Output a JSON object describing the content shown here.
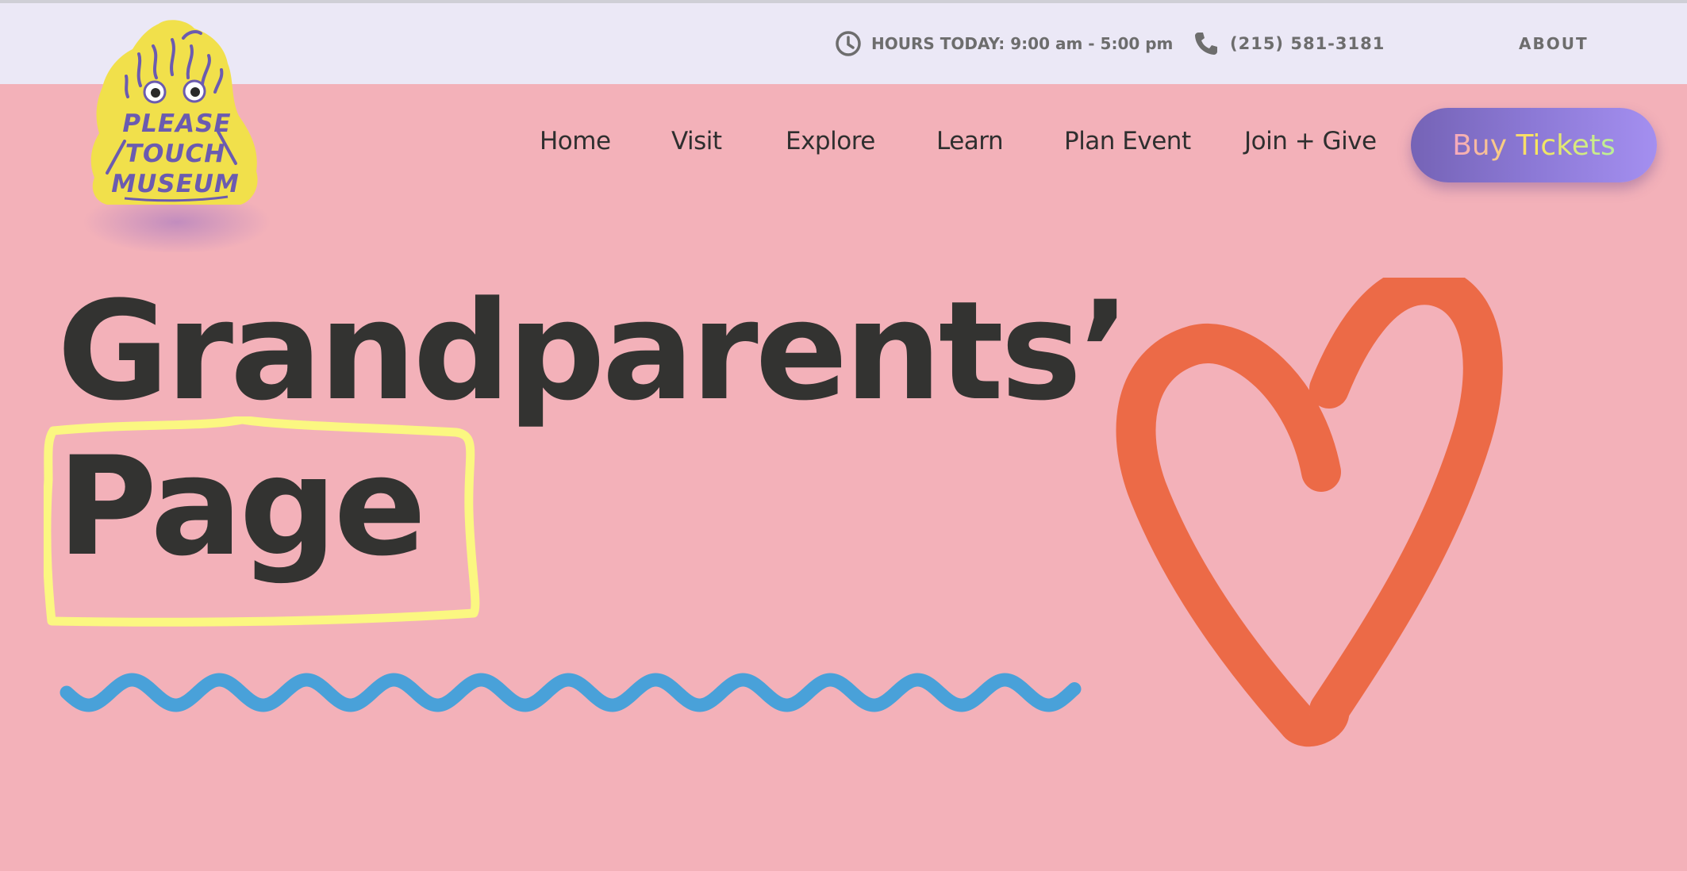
{
  "topbar": {
    "hours_label": "HOURS TODAY: 9:00 am - 5:00 pm",
    "phone": "(215) 581-3181",
    "about": "ABOUT"
  },
  "logo": {
    "line1": "PLEASE",
    "line2": "TOUCH",
    "line3": "MUSEUM"
  },
  "nav": {
    "items": [
      "Home",
      "Visit",
      "Explore",
      "Learn",
      "Plan Event",
      "Join + Give"
    ],
    "cta": "Buy Tickets"
  },
  "hero": {
    "title_line1": "Grandparents’",
    "title_line2": "Page"
  },
  "colors": {
    "background": "#f3b1b9",
    "topbar": "#ebe8f6",
    "heart": "#ec6a47",
    "wave": "#49a1d9",
    "highlight_box": "#fbf781",
    "logo": "#f1e04b",
    "logo_text": "#6b5bb0"
  },
  "icons": {
    "hours": "clock-icon",
    "phone": "phone-icon"
  }
}
